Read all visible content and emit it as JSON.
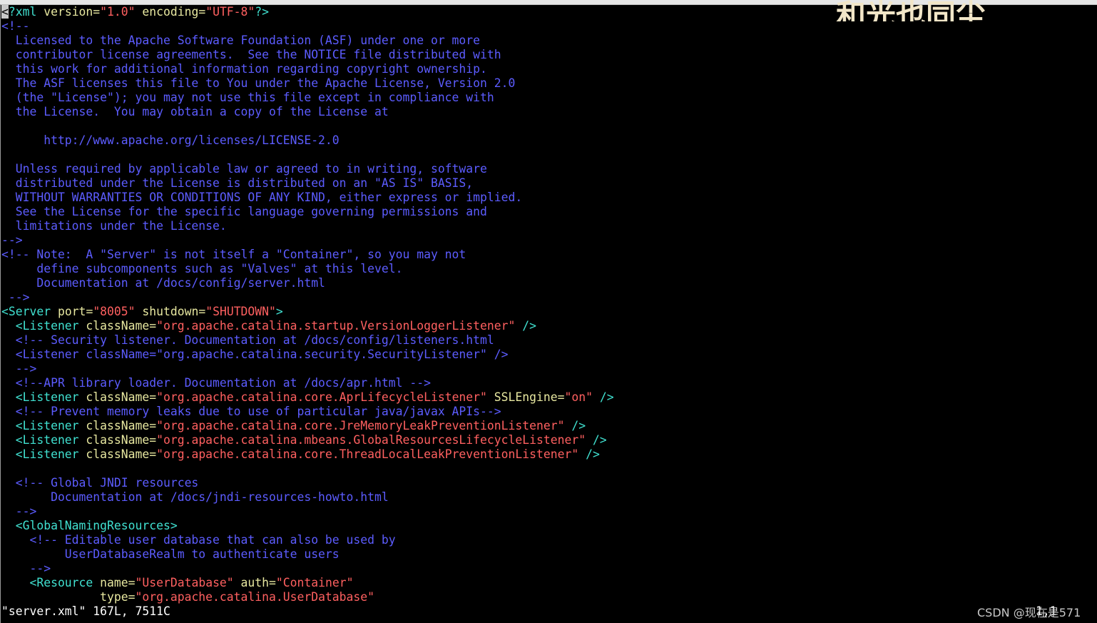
{
  "editor": {
    "filename_status": "\"server.xml\" 167L, 7511C",
    "cursor_pos": "1,1",
    "overlay_title": "和光也同尘",
    "watermark": "CSDN @现在是571"
  },
  "lines": [
    {
      "segs": [
        [
          "cursor",
          "<"
        ],
        [
          "tag",
          "?xml "
        ],
        [
          "attr",
          "version"
        ],
        [
          "punct",
          "="
        ],
        [
          "str",
          "\"1.0\""
        ],
        [
          "attr",
          " encoding"
        ],
        [
          "punct",
          "="
        ],
        [
          "str",
          "\"UTF-8\""
        ],
        [
          "tag",
          "?>"
        ]
      ]
    },
    {
      "segs": [
        [
          "cmt",
          "<!--"
        ]
      ]
    },
    {
      "segs": [
        [
          "cmt",
          "  Licensed to the Apache Software Foundation (ASF) under one or more"
        ]
      ]
    },
    {
      "segs": [
        [
          "cmt",
          "  contributor license agreements.  See the NOTICE file distributed with"
        ]
      ]
    },
    {
      "segs": [
        [
          "cmt",
          "  this work for additional information regarding copyright ownership."
        ]
      ]
    },
    {
      "segs": [
        [
          "cmt",
          "  The ASF licenses this file to You under the Apache License, Version 2.0"
        ]
      ]
    },
    {
      "segs": [
        [
          "cmt",
          "  (the \"License\"); you may not use this file except in compliance with"
        ]
      ]
    },
    {
      "segs": [
        [
          "cmt",
          "  the License.  You may obtain a copy of the License at"
        ]
      ]
    },
    {
      "segs": [
        [
          "cmt",
          ""
        ]
      ]
    },
    {
      "segs": [
        [
          "cmt",
          "      http://www.apache.org/licenses/LICENSE-2.0"
        ]
      ]
    },
    {
      "segs": [
        [
          "cmt",
          ""
        ]
      ]
    },
    {
      "segs": [
        [
          "cmt",
          "  Unless required by applicable law or agreed to in writing, software"
        ]
      ]
    },
    {
      "segs": [
        [
          "cmt",
          "  distributed under the License is distributed on an \"AS IS\" BASIS,"
        ]
      ]
    },
    {
      "segs": [
        [
          "cmt",
          "  WITHOUT WARRANTIES OR CONDITIONS OF ANY KIND, either express or implied."
        ]
      ]
    },
    {
      "segs": [
        [
          "cmt",
          "  See the License for the specific language governing permissions and"
        ]
      ]
    },
    {
      "segs": [
        [
          "cmt",
          "  limitations under the License."
        ]
      ]
    },
    {
      "segs": [
        [
          "cmt",
          "-->"
        ]
      ]
    },
    {
      "segs": [
        [
          "cmt",
          "<!-- Note:  A \"Server\" is not itself a \"Container\", so you may not"
        ]
      ]
    },
    {
      "segs": [
        [
          "cmt",
          "     define subcomponents such as \"Valves\" at this level."
        ]
      ]
    },
    {
      "segs": [
        [
          "cmt",
          "     Documentation at /docs/config/server.html"
        ]
      ]
    },
    {
      "segs": [
        [
          "cmt",
          " -->"
        ]
      ]
    },
    {
      "segs": [
        [
          "tag",
          "<Server "
        ],
        [
          "attr",
          "port"
        ],
        [
          "punct",
          "="
        ],
        [
          "str",
          "\"8005\""
        ],
        [
          "attr",
          " shutdown"
        ],
        [
          "punct",
          "="
        ],
        [
          "str",
          "\"SHUTDOWN\""
        ],
        [
          "tag",
          ">"
        ]
      ]
    },
    {
      "segs": [
        [
          "tag",
          "  <Listener "
        ],
        [
          "attr",
          "className"
        ],
        [
          "punct",
          "="
        ],
        [
          "str",
          "\"org.apache.catalina.startup.VersionLoggerListener\""
        ],
        [
          "tag",
          " />"
        ]
      ]
    },
    {
      "segs": [
        [
          "cmt",
          "  <!-- Security listener. Documentation at /docs/config/listeners.html"
        ]
      ]
    },
    {
      "segs": [
        [
          "cmt",
          "  <Listener className=\"org.apache.catalina.security.SecurityListener\" />"
        ]
      ]
    },
    {
      "segs": [
        [
          "cmt",
          "  -->"
        ]
      ]
    },
    {
      "segs": [
        [
          "cmt",
          "  <!--APR library loader. Documentation at /docs/apr.html -->"
        ]
      ]
    },
    {
      "segs": [
        [
          "tag",
          "  <Listener "
        ],
        [
          "attr",
          "className"
        ],
        [
          "punct",
          "="
        ],
        [
          "str",
          "\"org.apache.catalina.core.AprLifecycleListener\""
        ],
        [
          "attr",
          " SSLEngine"
        ],
        [
          "punct",
          "="
        ],
        [
          "str",
          "\"on\""
        ],
        [
          "tag",
          " />"
        ]
      ]
    },
    {
      "segs": [
        [
          "cmt",
          "  <!-- Prevent memory leaks due to use of particular java/javax APIs-->"
        ]
      ]
    },
    {
      "segs": [
        [
          "tag",
          "  <Listener "
        ],
        [
          "attr",
          "className"
        ],
        [
          "punct",
          "="
        ],
        [
          "str",
          "\"org.apache.catalina.core.JreMemoryLeakPreventionListener\""
        ],
        [
          "tag",
          " />"
        ]
      ]
    },
    {
      "segs": [
        [
          "tag",
          "  <Listener "
        ],
        [
          "attr",
          "className"
        ],
        [
          "punct",
          "="
        ],
        [
          "str",
          "\"org.apache.catalina.mbeans.GlobalResourcesLifecycleListener\""
        ],
        [
          "tag",
          " />"
        ]
      ]
    },
    {
      "segs": [
        [
          "tag",
          "  <Listener "
        ],
        [
          "attr",
          "className"
        ],
        [
          "punct",
          "="
        ],
        [
          "str",
          "\"org.apache.catalina.core.ThreadLocalLeakPreventionListener\""
        ],
        [
          "tag",
          " />"
        ]
      ]
    },
    {
      "segs": [
        [
          "cmt",
          ""
        ]
      ]
    },
    {
      "segs": [
        [
          "cmt",
          "  <!-- Global JNDI resources"
        ]
      ]
    },
    {
      "segs": [
        [
          "cmt",
          "       Documentation at /docs/jndi-resources-howto.html"
        ]
      ]
    },
    {
      "segs": [
        [
          "cmt",
          "  -->"
        ]
      ]
    },
    {
      "segs": [
        [
          "tag",
          "  <GlobalNamingResources>"
        ]
      ]
    },
    {
      "segs": [
        [
          "cmt",
          "    <!-- Editable user database that can also be used by"
        ]
      ]
    },
    {
      "segs": [
        [
          "cmt",
          "         UserDatabaseRealm to authenticate users"
        ]
      ]
    },
    {
      "segs": [
        [
          "cmt",
          "    -->"
        ]
      ]
    },
    {
      "segs": [
        [
          "tag",
          "    <Resource "
        ],
        [
          "attr",
          "name"
        ],
        [
          "punct",
          "="
        ],
        [
          "str",
          "\"UserDatabase\""
        ],
        [
          "attr",
          " auth"
        ],
        [
          "punct",
          "="
        ],
        [
          "str",
          "\"Container\""
        ]
      ]
    },
    {
      "segs": [
        [
          "attr",
          "              type"
        ],
        [
          "punct",
          "="
        ],
        [
          "str",
          "\"org.apache.catalina.UserDatabase\""
        ]
      ]
    }
  ]
}
